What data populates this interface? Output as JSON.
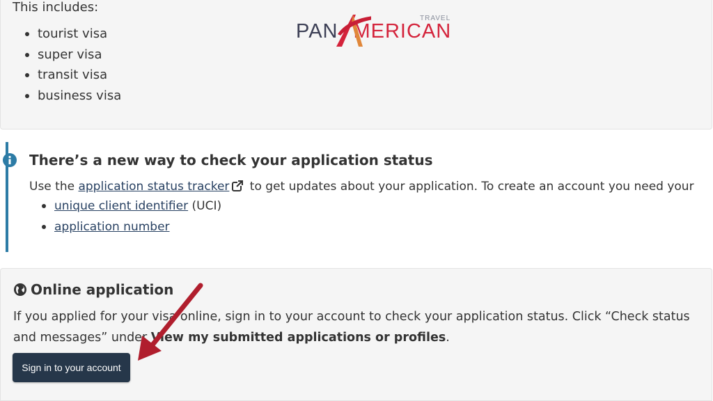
{
  "visa_section": {
    "intro": "This includes:",
    "items": [
      "tourist visa",
      "super visa",
      "transit visa",
      "business visa"
    ]
  },
  "logo": {
    "text_pan": "PAN",
    "text_merican": "MERICAN",
    "text_travel": "TRAVEL"
  },
  "alert": {
    "icon": "info-circle-icon",
    "heading": "There’s a new way to check your application status",
    "text_before": "Use the ",
    "tracker_link": "application status tracker",
    "text_after": " to get updates about your application. To create an account you need your",
    "items": [
      {
        "link": "unique client identifier",
        "suffix": " (UCI)"
      },
      {
        "link": "application number",
        "suffix": ""
      }
    ]
  },
  "online": {
    "icon": "globe-icon",
    "heading": "Online application",
    "text_1": "If you applied for your visa online, sign in to your account to check your application status. Click “Check status and messages” under ",
    "bold": "View my submitted applications or profiles",
    "text_2": ".",
    "button_label": "Sign in to your account"
  },
  "colors": {
    "accent": "#26374a",
    "link": "#284162",
    "alert_border": "#2d7ca6",
    "annotation_arrow": "#b01e2d"
  }
}
